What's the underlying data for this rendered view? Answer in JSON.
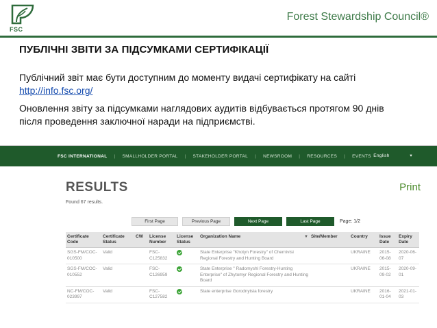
{
  "header": {
    "logo_text": "FSC",
    "brand_name": "Forest Stewardship Council®",
    "colors": {
      "brand_green": "#2e6b3b",
      "nav_green": "#1f5a2b",
      "link_blue": "#1a4fb0"
    }
  },
  "slide": {
    "title": "ПУБЛІЧНІ ЗВІТИ ЗА ПІДСУМКАМИ СЕРТИФІКАЦІЇ",
    "para1_text": "Публічний звіт має бути доступним до моменту видачі сертифікату на сайті ",
    "para1_link": "http://info.fsc.org/",
    "para2_text": "Оновлення звіту за підсумками наглядових аудитів відбувається протягом 90 днів після проведення заключної наради на підприємстві."
  },
  "web": {
    "nav": {
      "items": [
        "FSC INTERNATIONAL",
        "SMALLHOLDER PORTAL",
        "STAKEHOLDER PORTAL",
        "NEWSROOM",
        "RESOURCES",
        "EVENTS"
      ],
      "language": "English"
    },
    "results_title": "RESULTS",
    "print_label": "Print",
    "found_text": "Found 67 results.",
    "pager": {
      "first": "First Page",
      "previous": "Previous Page",
      "next": "Next Page",
      "last": "Last Page",
      "page_label": "Page: 1/2"
    },
    "table": {
      "headers": {
        "code": "Certificate Code",
        "status": "Certificate Status",
        "cw": "CW",
        "license": "License Number",
        "license_status": "License Status",
        "org": "Organization Name",
        "site": "Site/Member",
        "country": "Country",
        "issue": "Issue Date",
        "expiry": "Expiry Date"
      },
      "rows": [
        {
          "code": "SGS-FM/COC-010500",
          "status": "Valid",
          "cw": "",
          "license": "FSC-C125832",
          "org": "State Enterprise \"Khotyn Forestry\" of Chernivtsi Regional Forestry and Hunting Board",
          "site": "",
          "country": "UKRAINE",
          "issue": "2015-06-08",
          "expiry": "2020-06-07"
        },
        {
          "code": "SGS-FM/COC-010552",
          "status": "Valid",
          "cw": "",
          "license": "FSC-C126959",
          "org": "State Enterprise \" Radomyshl Forestry-Hunting Enterprise\" of Zhytomyr Regional Forestry and Hunting Board",
          "site": "",
          "country": "UKRAINE",
          "issue": "2015-09-02",
          "expiry": "2020-09-01"
        },
        {
          "code": "NC-FM/COC-023997",
          "status": "Valid",
          "cw": "",
          "license": "FSC-C127582",
          "org": "State enterprise Gorodnytsia forestry",
          "site": "",
          "country": "UKRAINE",
          "issue": "2016-01-04",
          "expiry": "2021-01-03"
        }
      ]
    }
  }
}
